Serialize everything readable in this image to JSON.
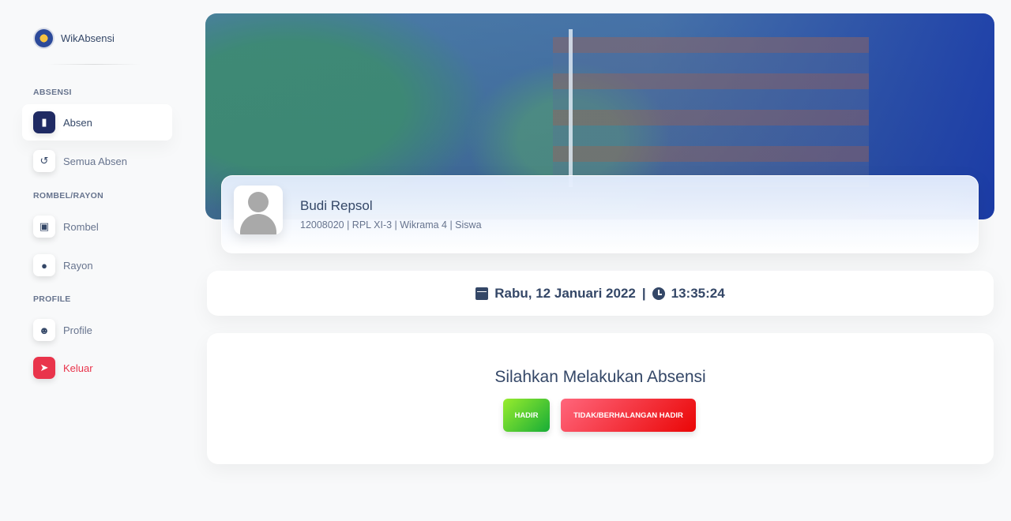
{
  "brand": {
    "name": "WikAbsensi"
  },
  "sidebar": {
    "sections": [
      {
        "label": "ABSENSI"
      },
      {
        "label": "ROMBEL/RAYON"
      },
      {
        "label": "PROFILE"
      }
    ],
    "items": [
      {
        "label": "Absen",
        "icon": "clipboard-icon",
        "active": true
      },
      {
        "label": "Semua Absen",
        "icon": "history-icon"
      },
      {
        "label": "Rombel",
        "icon": "chalkboard-icon"
      },
      {
        "label": "Rayon",
        "icon": "people-icon"
      },
      {
        "label": "Profile",
        "icon": "user-icon"
      },
      {
        "label": "Keluar",
        "icon": "logout-icon",
        "color": "#e9344b"
      }
    ]
  },
  "profile": {
    "name": "Budi Repsol",
    "meta": "12008020 | RPL XI-3 | Wikrama 4 | Siswa"
  },
  "datetime": {
    "date": "Rabu, 12 Januari 2022",
    "separator": "|",
    "time": "13:35:24"
  },
  "absensi": {
    "title": "Silahkan Melakukan Absensi",
    "hadir_label": "HADIR",
    "tidak_label": "TIDAK/BERHALANGAN HADIR"
  },
  "colors": {
    "primary_text": "#344767",
    "active_icon_bg": "#1f2a63",
    "danger": "#e9344b",
    "success": "#17ad37"
  }
}
